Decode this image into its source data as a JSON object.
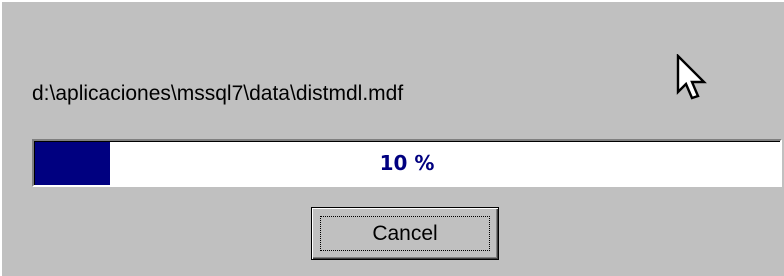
{
  "dialog": {
    "file_path": "d:\\aplicaciones\\mssql7\\data\\distmdl.mdf",
    "progress": {
      "percent": 10,
      "label": "10 %",
      "fill_color": "#000080",
      "text_color": "#000080"
    },
    "cancel_label": "Cancel",
    "cursor_icon": "arrow-cursor-icon"
  }
}
